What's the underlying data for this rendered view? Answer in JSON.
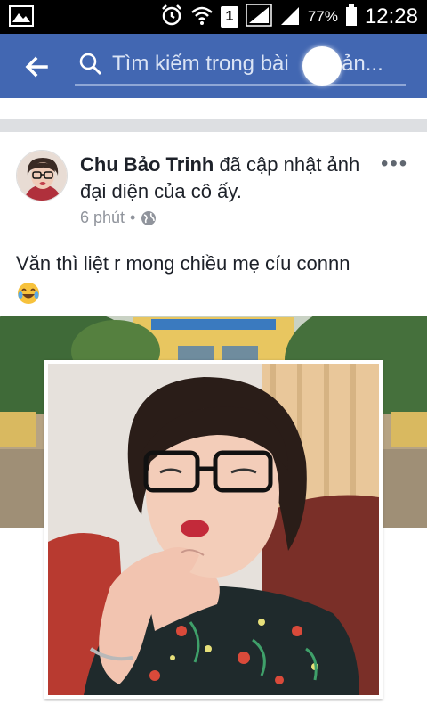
{
  "status_bar": {
    "sim_slot": "1",
    "battery": "77%",
    "time": "12:28"
  },
  "search": {
    "placeholder": "Tìm kiếm trong bài viết, ảnh..."
  },
  "search_visible": "Tìm kiếm trong bài",
  "search_tail": ", ản...",
  "post": {
    "author": "Chu Bảo Trinh",
    "action": " đã cập nhật ảnh đại diện của cô ấy.",
    "time": "6 phút",
    "separator": "•",
    "caption": "Văn thì liệt r mong chiều mẹ cíu connn",
    "more": "•••"
  },
  "icons": {
    "back": "arrow-left-icon",
    "search": "search-icon",
    "privacy": "globe-icon",
    "emoji": "crying-laughing-emoji-icon"
  },
  "colors": {
    "app_bar": "#4267b2",
    "separator": "#dddfe2",
    "meta_text": "#90949c"
  }
}
